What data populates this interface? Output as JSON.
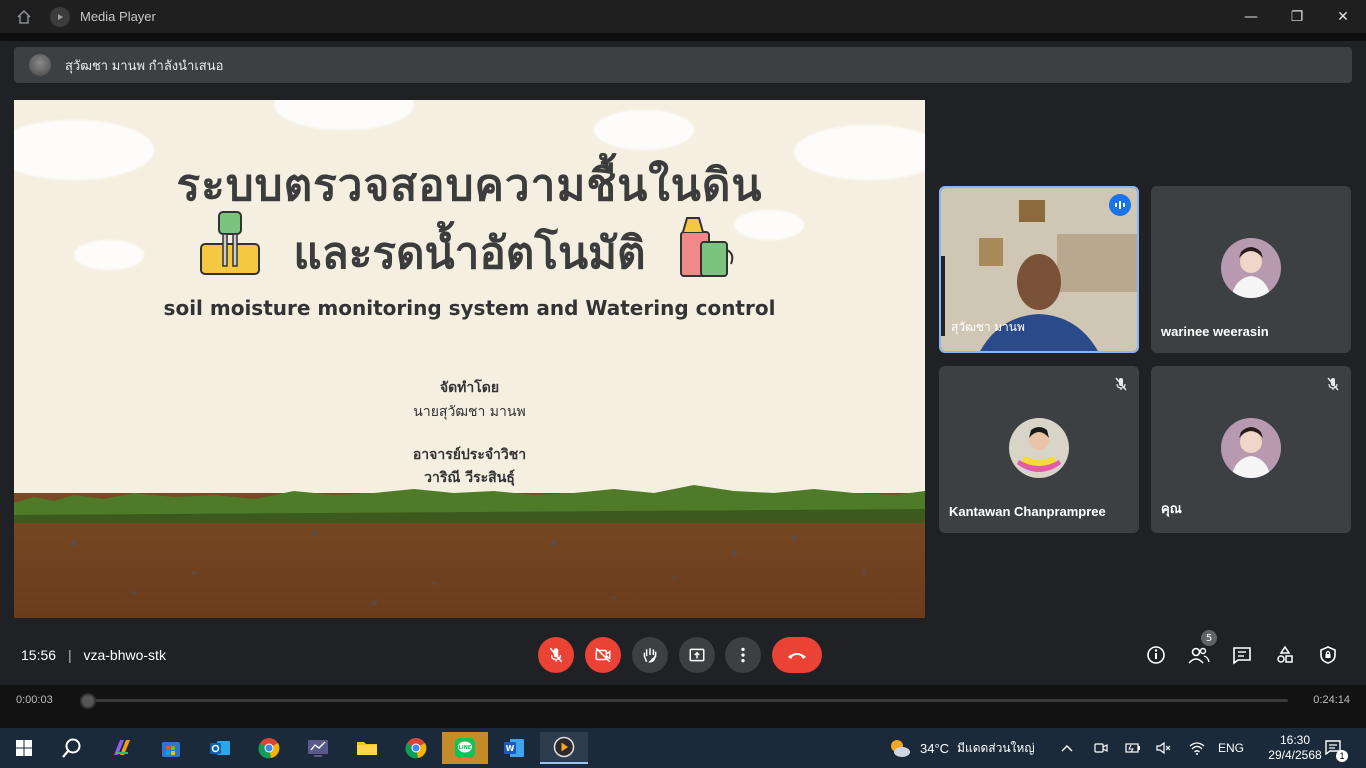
{
  "window": {
    "title": "Media Player",
    "minimize": "—",
    "restore": "❐",
    "close": "✕"
  },
  "presenter": {
    "text": "สุวัฒชา มานพ กำลังนำเสนอ"
  },
  "slide": {
    "title_line1": "ระบบตรวจสอบความชื้นในดิน",
    "title_line2": "และรดน้ำอัตโนมัติ",
    "subtitle": "soil moisture monitoring system and Watering control",
    "made_by_label": "จัดทำโดย",
    "made_by_name": "นายสุวัฒชา มานพ",
    "advisor_label": "อาจารย์ประจำวิชา",
    "advisor_name": "วาริณี วีระสินธุ์"
  },
  "participants": [
    {
      "name": "สุวัฒชา มานพ",
      "speaking": true
    },
    {
      "name": "warinee weerasin",
      "muted": false
    },
    {
      "name": "Kantawan Chanprampree",
      "muted": true
    },
    {
      "name": "คุณ",
      "muted": true
    }
  ],
  "meeting": {
    "time": "15:56",
    "separator": "|",
    "code": "vza-bhwo-stk",
    "people_count": "5"
  },
  "player": {
    "current": "0:00:03",
    "duration": "0:24:14",
    "progress": 0.002
  },
  "tray": {
    "weather_temp": "34°C",
    "weather_text": "มีแดดส่วนใหญ่",
    "lang": "ENG",
    "clock_time": "16:30",
    "clock_date": "29/4/2568",
    "notif_count": "1"
  },
  "colors": {
    "end_call": "#ea4335",
    "tile_bg": "#3c4043",
    "speaking_border": "#8ab4f8"
  }
}
